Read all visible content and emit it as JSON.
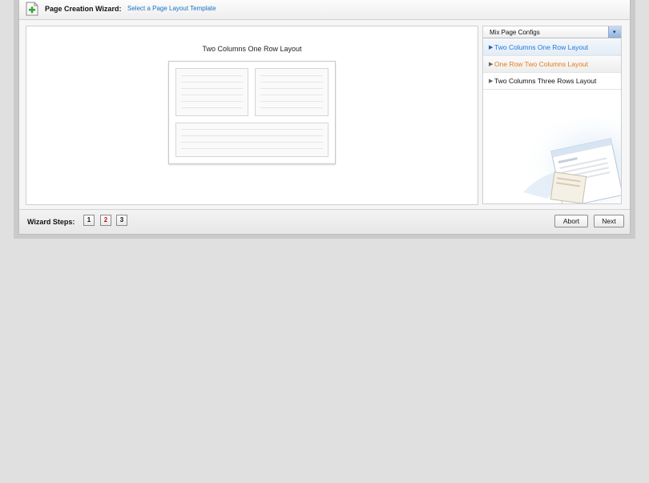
{
  "header": {
    "title": "Page Creation Wizard:",
    "subtitle": "Select a Page Layout Template",
    "icon": "add-page-icon"
  },
  "preview": {
    "title": "Two Columns One Row Layout"
  },
  "layout_select": {
    "selected": "Mix Page Configs",
    "options": [
      {
        "label": "Two Columns One Row Layout",
        "state": "selected"
      },
      {
        "label": "One Row Two Columns Layout",
        "state": "hover"
      },
      {
        "label": "Two Columns Three Rows Layout",
        "state": "normal"
      }
    ]
  },
  "footer": {
    "steps_label": "Wizard Steps:",
    "steps": [
      "1",
      "2",
      "3"
    ],
    "current_step": "2",
    "abort_label": "Abort",
    "next_label": "Next"
  },
  "colors": {
    "link_blue": "#1f7ad6",
    "hover_orange": "#e67c1a",
    "active_step_red": "#d10f0f"
  }
}
